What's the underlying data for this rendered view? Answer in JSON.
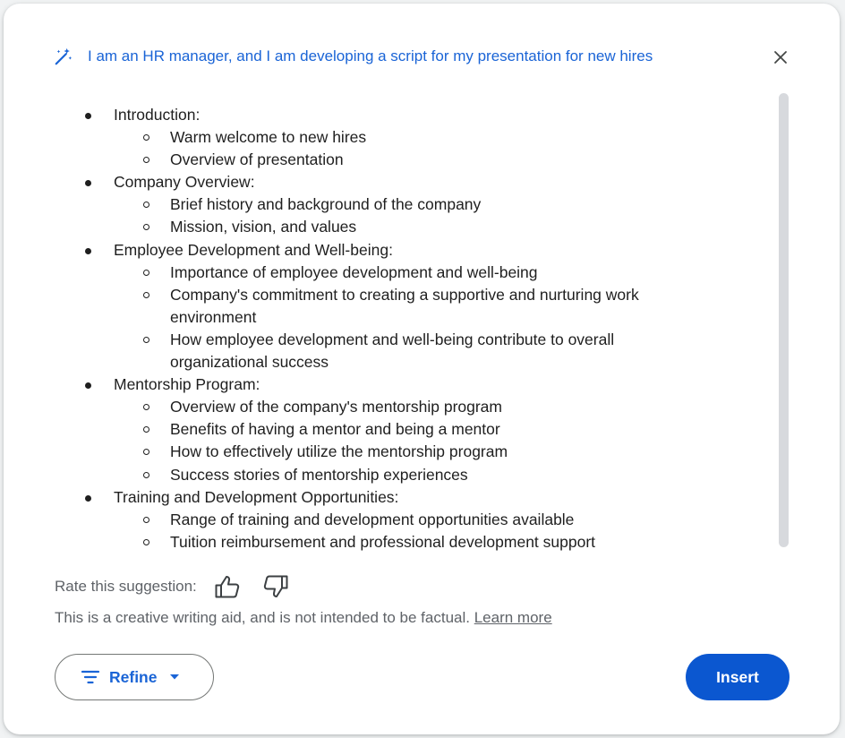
{
  "prompt": {
    "text": "I am an HR manager, and I am developing a script for my presentation for new hires"
  },
  "outline": [
    {
      "label": "Introduction:",
      "children": [
        "Warm welcome to new hires",
        "Overview of presentation"
      ]
    },
    {
      "label": "Company Overview:",
      "children": [
        "Brief history and background of the company",
        "Mission, vision, and values"
      ]
    },
    {
      "label": "Employee Development and Well-being:",
      "children": [
        "Importance of employee development and well-being",
        "Company's commitment to creating a supportive and nurturing work environment",
        "How employee development and well-being contribute to overall organizational success"
      ]
    },
    {
      "label": "Mentorship Program:",
      "children": [
        "Overview of the company's mentorship program",
        "Benefits of having a mentor and being a mentor",
        "How to effectively utilize the mentorship program",
        "Success stories of mentorship experiences"
      ]
    },
    {
      "label": "Training and Development Opportunities:",
      "children": [
        "Range of training and development opportunities available",
        "Tuition reimbursement and professional development support"
      ]
    }
  ],
  "rating": {
    "label": "Rate this suggestion:",
    "thumbs_up_icon": "thumbs-up-icon",
    "thumbs_down_icon": "thumbs-down-icon"
  },
  "disclaimer": {
    "text": "This is a creative writing aid, and is not intended to be factual.",
    "link": "Learn more"
  },
  "actions": {
    "refine_label": "Refine",
    "insert_label": "Insert"
  },
  "colors": {
    "accent": "#1a64d6",
    "primary_button": "#0b57d0",
    "muted_text": "#5f6368",
    "body_text": "#1f1f1f",
    "scrollbar": "#d7d9dd"
  }
}
